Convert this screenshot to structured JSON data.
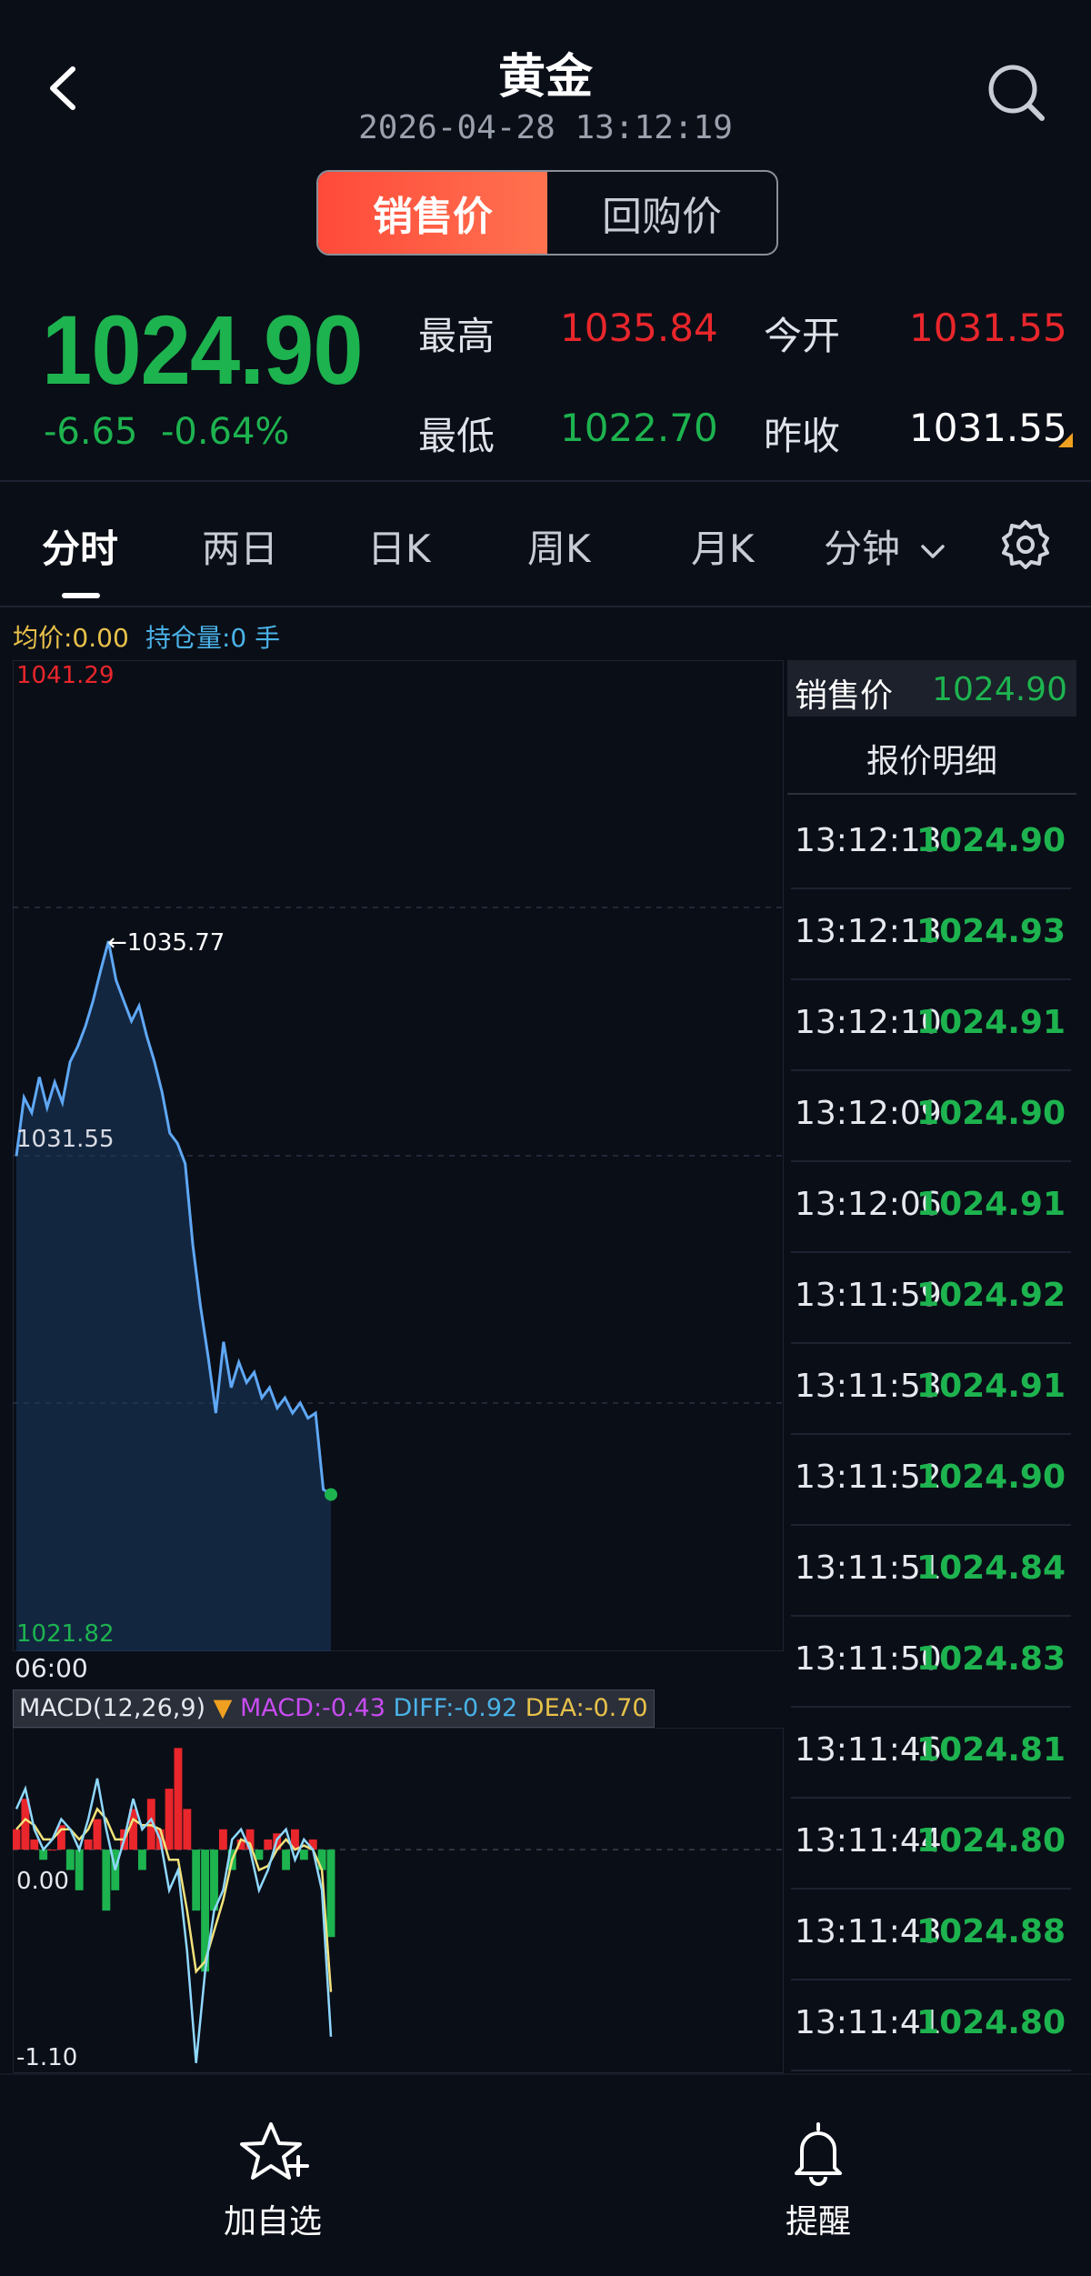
{
  "header": {
    "title": "黄金",
    "datetime": "2026-04-28 13:12:19",
    "segments": [
      "销售价",
      "回购价"
    ]
  },
  "quote": {
    "price": "1024.90",
    "change": "-6.65",
    "change_pct": "-0.64%",
    "high_label": "最高",
    "high": "1035.84",
    "open_label": "今开",
    "open": "1031.55",
    "low_label": "最低",
    "low": "1022.70",
    "prev_label": "昨收",
    "prev": "1031.55"
  },
  "tabs": [
    "分时",
    "两日",
    "日K",
    "周K",
    "月K",
    "分钟"
  ],
  "chart_stats": {
    "avg": "均价:0.00",
    "holding": "持仓量:0 手"
  },
  "chart_data": [
    {
      "type": "line",
      "max_label": "1041.29",
      "prev_close_label": "1031.55",
      "min_label": "1021.82",
      "peak_annotation": "←1035.77",
      "time_label": "06:00",
      "ylim": [
        1021.82,
        1041.29
      ],
      "y": [
        1031.55,
        1032.7,
        1032.4,
        1033.1,
        1032.5,
        1033.0,
        1032.6,
        1033.4,
        1033.7,
        1034.1,
        1034.6,
        1035.2,
        1035.77,
        1035.0,
        1034.6,
        1034.2,
        1034.5,
        1033.9,
        1033.4,
        1032.8,
        1032.0,
        1031.8,
        1031.4,
        1029.8,
        1028.6,
        1027.6,
        1026.5,
        1027.9,
        1027.0,
        1027.5,
        1027.1,
        1027.3,
        1026.8,
        1027.0,
        1026.6,
        1026.8,
        1026.5,
        1026.7,
        1026.4,
        1026.5,
        1025.0,
        1024.9
      ]
    },
    {
      "type": "line",
      "title": "MACD(12,26,9)",
      "macd_label": "MACD:-0.43",
      "diff_label": "DIFF:-0.92",
      "dea_label": "DEA:-0.70",
      "zero_label": "0.00",
      "min_label": "-1.10",
      "ylim": [
        -1.1,
        0.6
      ],
      "macd": [
        0.1,
        0.25,
        0.05,
        -0.05,
        0.0,
        0.12,
        -0.1,
        -0.2,
        0.05,
        0.15,
        -0.3,
        -0.2,
        0.1,
        0.2,
        -0.1,
        0.25,
        0.1,
        0.3,
        0.5,
        0.2,
        -0.3,
        -0.6,
        -0.3,
        0.1,
        -0.1,
        0.05,
        0.1,
        -0.05,
        0.05,
        0.08,
        -0.1,
        0.1,
        -0.05,
        0.05,
        -0.1,
        -0.43
      ],
      "diff": [
        0.2,
        0.3,
        0.1,
        0.0,
        0.05,
        0.15,
        0.1,
        0.0,
        0.15,
        0.35,
        0.1,
        -0.1,
        0.05,
        0.25,
        0.1,
        0.15,
        0.05,
        -0.2,
        -0.1,
        -0.5,
        -1.05,
        -0.6,
        -0.3,
        -0.2,
        0.05,
        0.1,
        0.0,
        -0.2,
        -0.1,
        0.05,
        0.1,
        -0.05,
        0.05,
        0.0,
        -0.2,
        -0.92
      ],
      "dea": [
        0.1,
        0.15,
        0.12,
        0.05,
        0.05,
        0.1,
        0.1,
        0.05,
        0.1,
        0.2,
        0.15,
        0.05,
        0.05,
        0.15,
        0.12,
        0.12,
        0.1,
        -0.05,
        -0.05,
        -0.3,
        -0.6,
        -0.55,
        -0.4,
        -0.25,
        -0.05,
        0.05,
        0.03,
        -0.1,
        -0.08,
        0.0,
        0.05,
        0.0,
        0.02,
        0.0,
        -0.1,
        -0.7
      ]
    }
  ],
  "ticks": {
    "title_label": "销售价",
    "title_value": "1024.90",
    "subtitle": "报价明细",
    "rows": [
      {
        "time": "13:12:13",
        "price": "1024.90"
      },
      {
        "time": "13:12:13",
        "price": "1024.93"
      },
      {
        "time": "13:12:10",
        "price": "1024.91"
      },
      {
        "time": "13:12:09",
        "price": "1024.90"
      },
      {
        "time": "13:12:06",
        "price": "1024.91"
      },
      {
        "time": "13:11:59",
        "price": "1024.92"
      },
      {
        "time": "13:11:53",
        "price": "1024.91"
      },
      {
        "time": "13:11:52",
        "price": "1024.90"
      },
      {
        "time": "13:11:51",
        "price": "1024.84"
      },
      {
        "time": "13:11:50",
        "price": "1024.83"
      },
      {
        "time": "13:11:46",
        "price": "1024.81"
      },
      {
        "time": "13:11:44",
        "price": "1024.80"
      },
      {
        "time": "13:11:43",
        "price": "1024.88"
      },
      {
        "time": "13:11:41",
        "price": "1024.80"
      }
    ]
  },
  "bottom": {
    "watch_label": "加自选",
    "alert_label": "提醒"
  },
  "colors": {
    "up": "#e8262b",
    "down": "#1db34f",
    "line": "#5fa8f5",
    "accent": "#ff5a3d"
  }
}
